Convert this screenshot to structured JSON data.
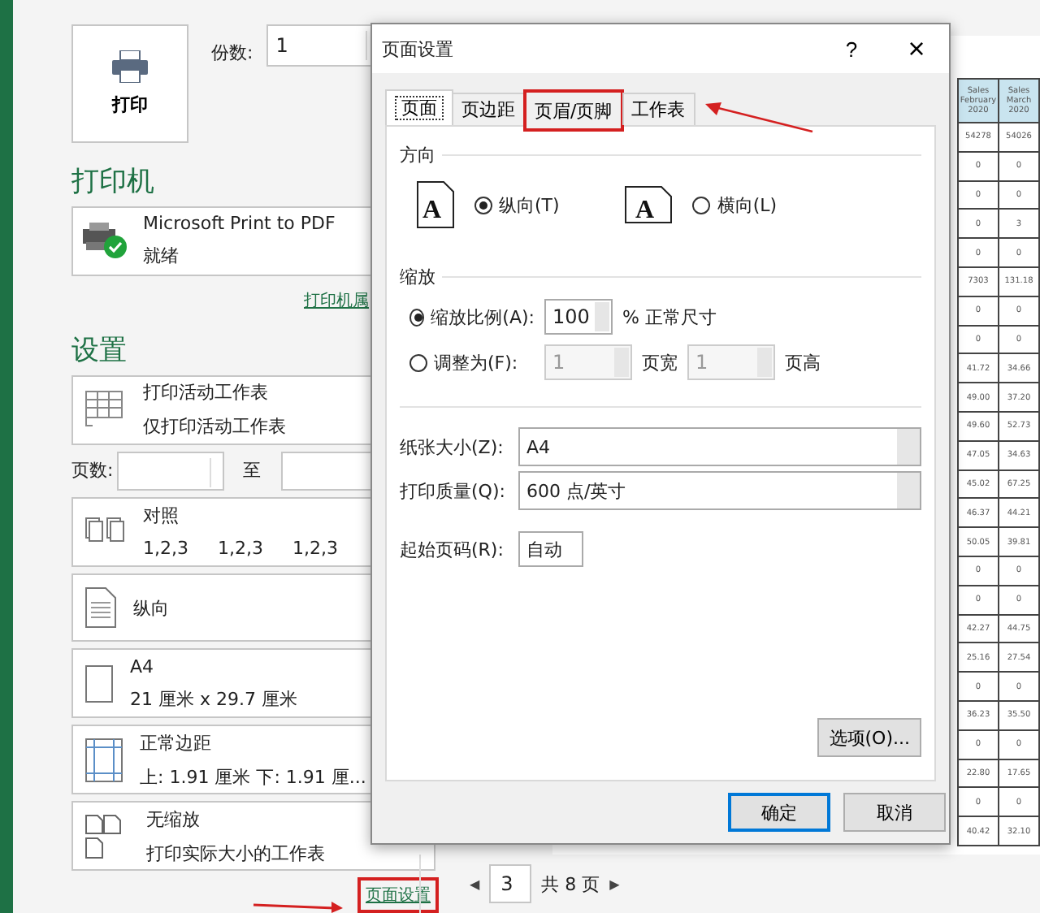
{
  "print_button": {
    "label": "打印"
  },
  "copies": {
    "label": "份数:",
    "value": "1"
  },
  "printer": {
    "heading": "打印机",
    "name": "Microsoft Print to PDF",
    "status": "就绪",
    "ready": true,
    "properties_link": "打印机属"
  },
  "settings": {
    "heading": "设置",
    "scope": {
      "title": "打印活动工作表",
      "subtitle": "仅打印活动工作表"
    },
    "pages": {
      "label": "页数:",
      "to": "至"
    },
    "options": [
      {
        "kind": "collate",
        "title": "对照",
        "parts": [
          "1,2,3",
          "1,2,3",
          "1,2,3"
        ]
      },
      {
        "kind": "portrait",
        "title": "纵向"
      },
      {
        "kind": "paper",
        "title": "A4",
        "parts": [
          "21 厘米 x 29.7 厘米"
        ]
      },
      {
        "kind": "margins",
        "title": "正常边距",
        "parts": [
          "上: 1.91 厘米 下: 1.91 厘..."
        ]
      },
      {
        "kind": "scaling",
        "title": "无缩放",
        "parts": [
          "打印实际大小的工作表"
        ]
      }
    ]
  },
  "page_setup_link": {
    "label": "页面设置",
    "annotated": true
  },
  "preview": {
    "columns": [
      "Sales February 2020",
      "Sales March 2020"
    ],
    "rows": [
      [
        "54278",
        "54026"
      ],
      [
        "0",
        "0"
      ],
      [
        "0",
        "0"
      ],
      [
        "0",
        "3"
      ],
      [
        "0",
        "0"
      ],
      [
        "7303",
        "131.18"
      ],
      [
        "0",
        "0"
      ],
      [
        "0",
        "0"
      ],
      [
        "41.72",
        "34.66"
      ],
      [
        "49.00",
        "37.20"
      ],
      [
        "49.60",
        "52.73"
      ],
      [
        "47.05",
        "34.63"
      ],
      [
        "45.02",
        "67.25"
      ],
      [
        "46.37",
        "44.21"
      ],
      [
        "50.05",
        "39.81"
      ],
      [
        "0",
        "0"
      ],
      [
        "0",
        "0"
      ],
      [
        "42.27",
        "44.75"
      ],
      [
        "25.16",
        "27.54"
      ],
      [
        "0",
        "0"
      ],
      [
        "36.23",
        "35.50"
      ],
      [
        "0",
        "0"
      ],
      [
        "22.80",
        "17.65"
      ],
      [
        "0",
        "0"
      ],
      [
        "40.42",
        "32.10"
      ]
    ]
  },
  "pagination": {
    "prev": "◀",
    "page": "3",
    "total": "共 8 页",
    "next": "▶"
  },
  "dialog": {
    "title": "页面设置",
    "help": "?",
    "close": "×",
    "tabs": [
      {
        "label": "页面",
        "selected": true,
        "annotated": false
      },
      {
        "label": "页边距",
        "selected": false,
        "annotated": false
      },
      {
        "label": "页眉/页脚",
        "selected": false,
        "annotated": true
      },
      {
        "label": "工作表",
        "selected": false,
        "annotated": false
      }
    ],
    "orientation": {
      "heading": "方向",
      "options": [
        {
          "kind": "portrait",
          "icon_letter": "A",
          "label": "纵向(T)",
          "selected": true
        },
        {
          "kind": "landscape",
          "icon_letter": "A",
          "label": "横向(L)",
          "selected": false
        }
      ]
    },
    "scaling": {
      "heading": "缩放",
      "options": [
        {
          "kind": "percent",
          "label": "缩放比例(A):",
          "selected": true,
          "disabled": false,
          "value": "100",
          "suffix": "% 正常尺寸"
        },
        {
          "kind": "fit",
          "label": "调整为(F):",
          "selected": false,
          "disabled": true,
          "wide": "1",
          "wide_label": "页宽",
          "tall": "1",
          "tall_label": "页高"
        }
      ]
    },
    "paper_size": {
      "label": "纸张大小(Z):",
      "value": "A4"
    },
    "print_quality": {
      "label": "打印质量(Q):",
      "value": "600 点/英寸"
    },
    "first_page": {
      "label": "起始页码(R):",
      "value": "自动"
    },
    "options_button": "选项(O)...",
    "ok": "确定",
    "cancel": "取消"
  }
}
